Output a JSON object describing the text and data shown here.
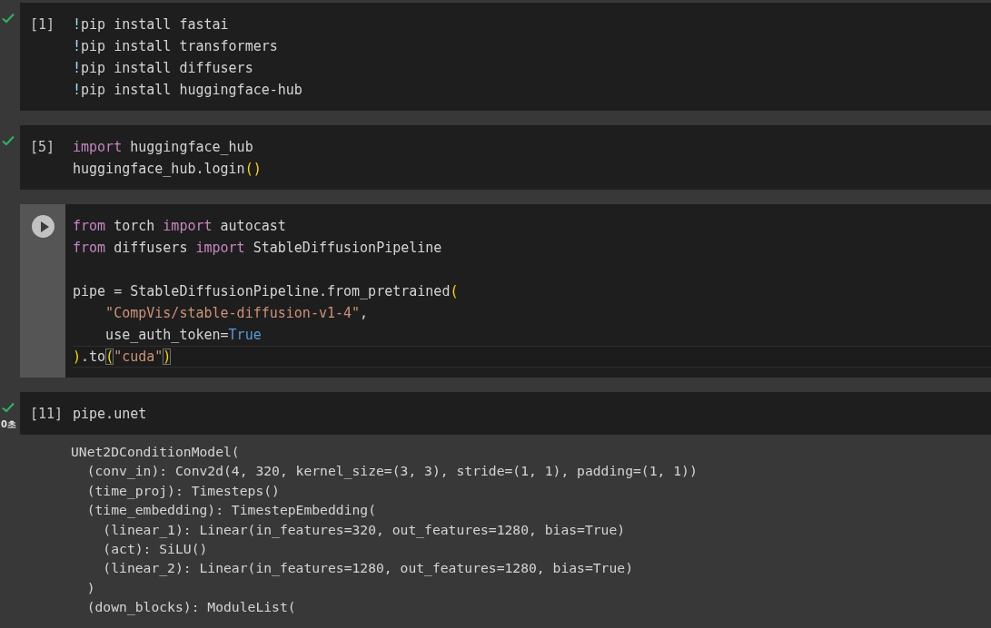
{
  "cells": [
    {
      "executed": true,
      "focused": false,
      "prompt": "[1]",
      "lines": [
        {
          "kind": "code",
          "tokens": [
            {
              "text": "!",
              "kind": "bang"
            },
            {
              "text": "pip install fastai",
              "kind": "plain"
            }
          ]
        },
        {
          "kind": "code",
          "tokens": [
            {
              "text": "!",
              "kind": "bang"
            },
            {
              "text": "pip install transformers",
              "kind": "plain"
            }
          ]
        },
        {
          "kind": "code",
          "tokens": [
            {
              "text": "!",
              "kind": "bang"
            },
            {
              "text": "pip install diffusers",
              "kind": "plain"
            }
          ]
        },
        {
          "kind": "code",
          "tokens": [
            {
              "text": "!",
              "kind": "bang"
            },
            {
              "text": "pip install huggingface-hub",
              "kind": "plain"
            }
          ]
        }
      ]
    },
    {
      "executed": true,
      "focused": false,
      "prompt": "[5]",
      "lines": [
        {
          "kind": "code",
          "tokens": [
            {
              "text": "import",
              "kind": "keyword"
            },
            {
              "text": " huggingface_hub",
              "kind": "plain"
            }
          ]
        },
        {
          "kind": "code",
          "tokens": [
            {
              "text": "huggingface_hub.login",
              "kind": "plain"
            },
            {
              "text": "()",
              "kind": "bracket"
            }
          ]
        }
      ]
    },
    {
      "executed": false,
      "focused": true,
      "lines": [
        {
          "kind": "code",
          "current": false,
          "tokens": [
            {
              "text": "from",
              "kind": "keyword"
            },
            {
              "text": " torch ",
              "kind": "plain"
            },
            {
              "text": "import",
              "kind": "keyword"
            },
            {
              "text": " autocast",
              "kind": "plain"
            }
          ]
        },
        {
          "kind": "code",
          "current": false,
          "tokens": [
            {
              "text": "from",
              "kind": "keyword"
            },
            {
              "text": " diffusers ",
              "kind": "plain"
            },
            {
              "text": "import",
              "kind": "keyword"
            },
            {
              "text": " StableDiffusionPipeline",
              "kind": "plain"
            }
          ]
        },
        {
          "kind": "blank",
          "current": false
        },
        {
          "kind": "code",
          "current": false,
          "tokens": [
            {
              "text": "pipe = StableDiffusionPipeline.from_pretrained",
              "kind": "plain"
            },
            {
              "text": "(",
              "kind": "bracket"
            }
          ]
        },
        {
          "kind": "code",
          "current": false,
          "tokens": [
            {
              "text": "    \"CompVis/stable-diffusion-v1-4\"",
              "kind": "string"
            },
            {
              "text": ",",
              "kind": "plain"
            }
          ]
        },
        {
          "kind": "code",
          "current": false,
          "tokens": [
            {
              "text": "    use_auth_token=",
              "kind": "plain"
            },
            {
              "text": "True",
              "kind": "bool"
            }
          ]
        },
        {
          "kind": "code",
          "current": true,
          "tokens": [
            {
              "text": ")",
              "kind": "bracket"
            },
            {
              "text": ".to",
              "kind": "plain"
            },
            {
              "text": "(",
              "kind": "bracket-match"
            },
            {
              "text": "\"cuda\"",
              "kind": "string"
            },
            {
              "text": ")",
              "kind": "bracket-match"
            }
          ]
        }
      ]
    },
    {
      "executed": true,
      "focused": false,
      "prompt": "[11]",
      "elapsed": "0초",
      "lines": [
        {
          "kind": "code",
          "tokens": [
            {
              "text": "pipe.unet",
              "kind": "plain"
            }
          ]
        }
      ],
      "output": [
        "UNet2DConditionModel(",
        "  (conv_in): Conv2d(4, 320, kernel_size=(3, 3), stride=(1, 1), padding=(1, 1))",
        "  (time_proj): Timesteps()",
        "  (time_embedding): TimestepEmbedding(",
        "    (linear_1): Linear(in_features=320, out_features=1280, bias=True)",
        "    (act): SiLU()",
        "    (linear_2): Linear(in_features=1280, out_features=1280, bias=True)",
        "  )",
        "  (down_blocks): ModuleList("
      ]
    }
  ]
}
